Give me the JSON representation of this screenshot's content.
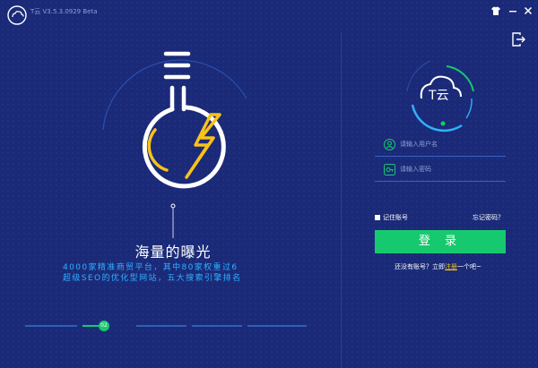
{
  "app": {
    "title": "T云 V3.5.3.0929 Beta"
  },
  "brand": {
    "logo_text": "T云"
  },
  "slide": {
    "headline": "海量的曝光",
    "desc_line1": "4000家精准商贸平台，其中80家权重过6",
    "desc_line2": "超级SEO的优化型网站，五大搜索引擎排名",
    "current_step": "02"
  },
  "login": {
    "username_placeholder": "请输入用户名",
    "password_placeholder": "请输入密码",
    "remember_label": "记住账号",
    "forgot_label": "忘记密码？",
    "submit_label": "登 录",
    "signup_prefix": "还没有账号？立即",
    "signup_link": "注册",
    "signup_suffix": "一个吧~"
  },
  "colors": {
    "background": "#1a2a78",
    "accent_green": "#17c96e",
    "accent_blue": "#2fb0ff",
    "accent_yellow": "#f7c21a"
  }
}
